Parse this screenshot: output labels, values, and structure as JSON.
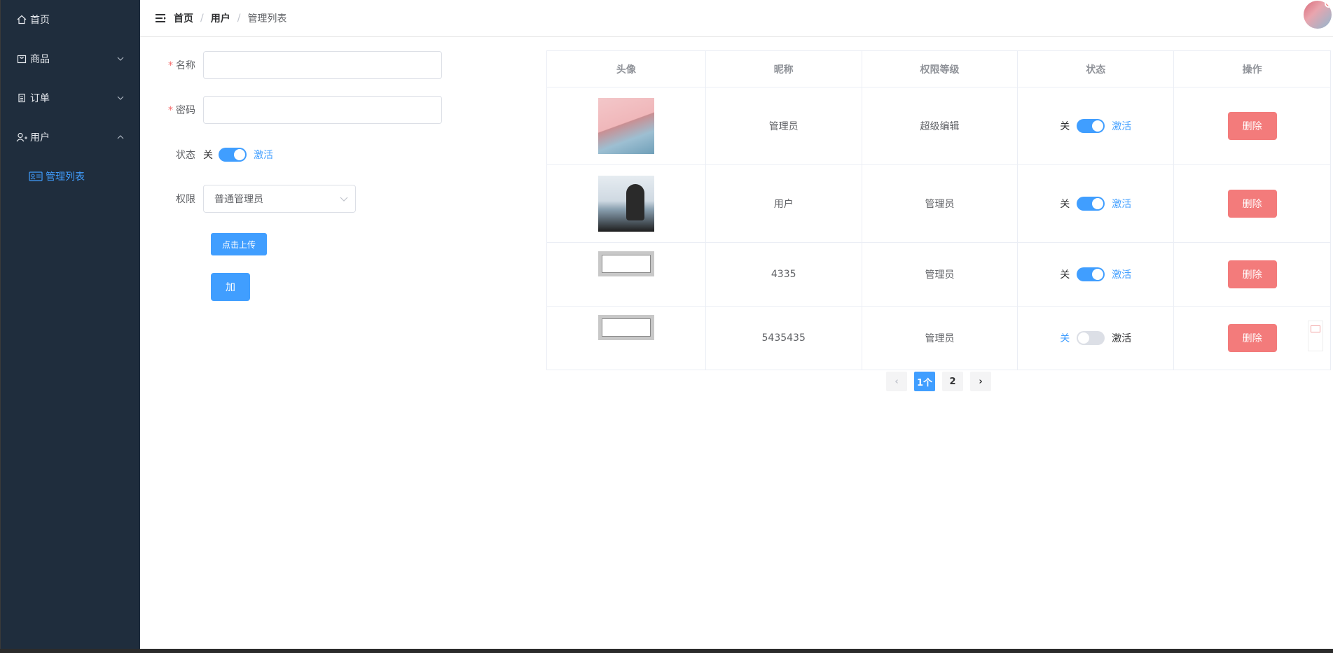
{
  "sidebar": {
    "items": [
      {
        "label": "首页",
        "icon": "home-icon"
      },
      {
        "label": "商品",
        "icon": "bag-icon"
      },
      {
        "label": "订单",
        "icon": "document-icon"
      },
      {
        "label": "用户",
        "icon": "user-add-icon"
      }
    ],
    "submenu": {
      "label": "管理列表",
      "icon": "id-card-icon"
    },
    "colors": {
      "bg": "#1f2d3d",
      "active": "#409eff"
    }
  },
  "header": {
    "breadcrumb": [
      "首页",
      "用户",
      "管理列表"
    ],
    "separator": "/"
  },
  "form": {
    "name_label": "名称",
    "password_label": "密码",
    "name_value": "",
    "password_value": "",
    "status_label": "状态",
    "status_off": "关",
    "status_on": "激活",
    "permission_label": "权限",
    "permission_value": "普通管理员",
    "upload_label": "点击上传",
    "add_label": "加"
  },
  "table": {
    "headers": [
      "头像",
      "昵称",
      "权限等级",
      "状态",
      "操作"
    ],
    "rows": [
      {
        "nickname": "管理员",
        "level": "超级编辑",
        "status_off": "关",
        "status_on": "激活",
        "enabled": true,
        "action": "删除"
      },
      {
        "nickname": "用户",
        "level": "管理员",
        "status_off": "关",
        "status_on": "激活",
        "enabled": true,
        "action": "删除"
      },
      {
        "nickname": "4335",
        "level": "管理员",
        "status_off": "关",
        "status_on": "激活",
        "enabled": true,
        "action": "删除"
      },
      {
        "nickname": "5435435",
        "level": "管理员",
        "status_off": "关",
        "status_on": "激活",
        "enabled": false,
        "action": "删除"
      }
    ]
  },
  "pagination": {
    "prev": "‹",
    "pages": [
      "1个",
      "2"
    ],
    "current": "1个",
    "next": "›"
  },
  "colors": {
    "primary": "#409eff",
    "danger": "#f37b7b"
  }
}
